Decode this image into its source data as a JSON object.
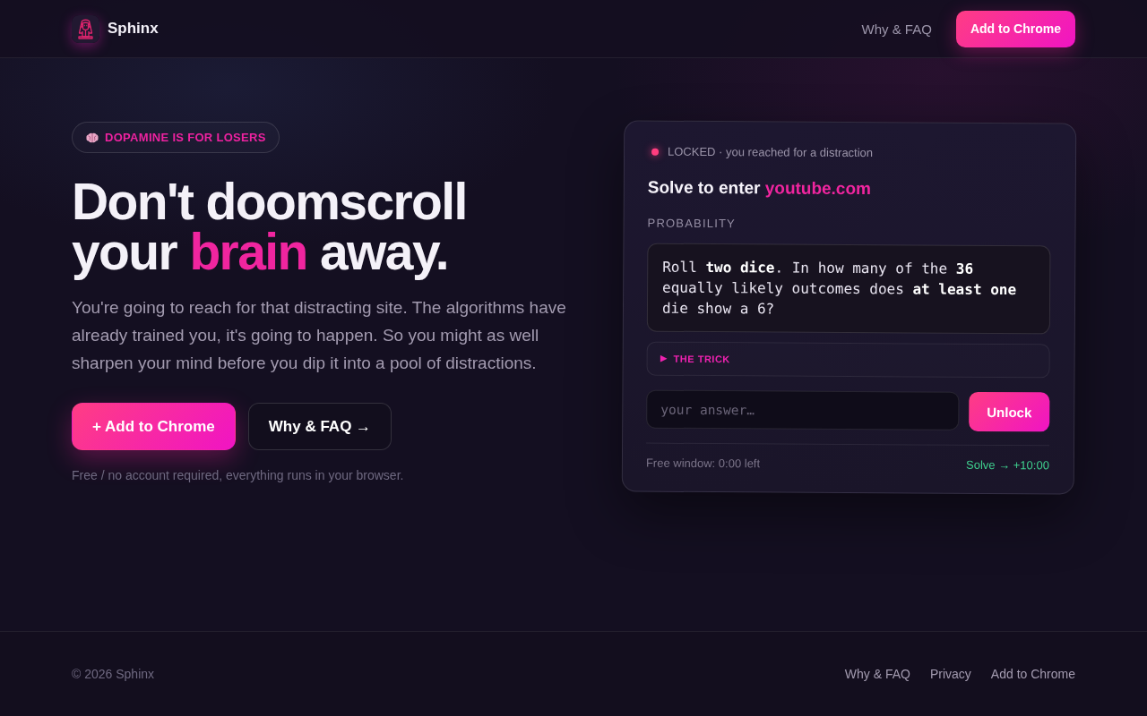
{
  "header": {
    "brand": "Sphinx",
    "nav": [
      {
        "kind": "link",
        "label": "Why & FAQ"
      },
      {
        "kind": "button",
        "label": "Add to Chrome"
      }
    ]
  },
  "hero": {
    "badge": "DOPAMINE IS FOR LOSERS",
    "headline": [
      {
        "text": "Don't doomscroll your",
        "highlight": false
      },
      {
        "text": "brain",
        "highlight": true
      },
      {
        "text": "away.",
        "highlight": false
      }
    ],
    "lede": "You're going to reach for that distracting site. The algorithms have already trained you, it's going to happen. So you might as well sharpen your mind before you dip it into a pool of distractions.",
    "actions": [
      {
        "kind": "primary",
        "label": "+ Add to Chrome"
      },
      {
        "kind": "secondary",
        "label": "Why & FAQ →"
      }
    ],
    "note": "Free / no account required, everything runs in your browser."
  },
  "challenge": {
    "status": {
      "locked": true,
      "text": "LOCKED · you reached for a distraction"
    },
    "title": [
      {
        "text": "Solve to enter",
        "highlight": false
      },
      {
        "text": "youtube.com",
        "highlight": true
      }
    ],
    "category": "PROBABILITY",
    "question": "Roll **two dice**. In how many of the **36** equally likely outcomes does **at least one** die show a 6?",
    "hint": {
      "label": "THE TRICK",
      "expanded": false
    },
    "answer": {
      "placeholder": "your answer…"
    },
    "submit": "Unlock",
    "timer": "Free window: 0:00 left",
    "reward": "Solve → +10:00"
  },
  "footer": {
    "copyright": "© 2026 Sphinx",
    "links": [
      "Why & FAQ",
      "Privacy",
      "Add to Chrome"
    ]
  }
}
